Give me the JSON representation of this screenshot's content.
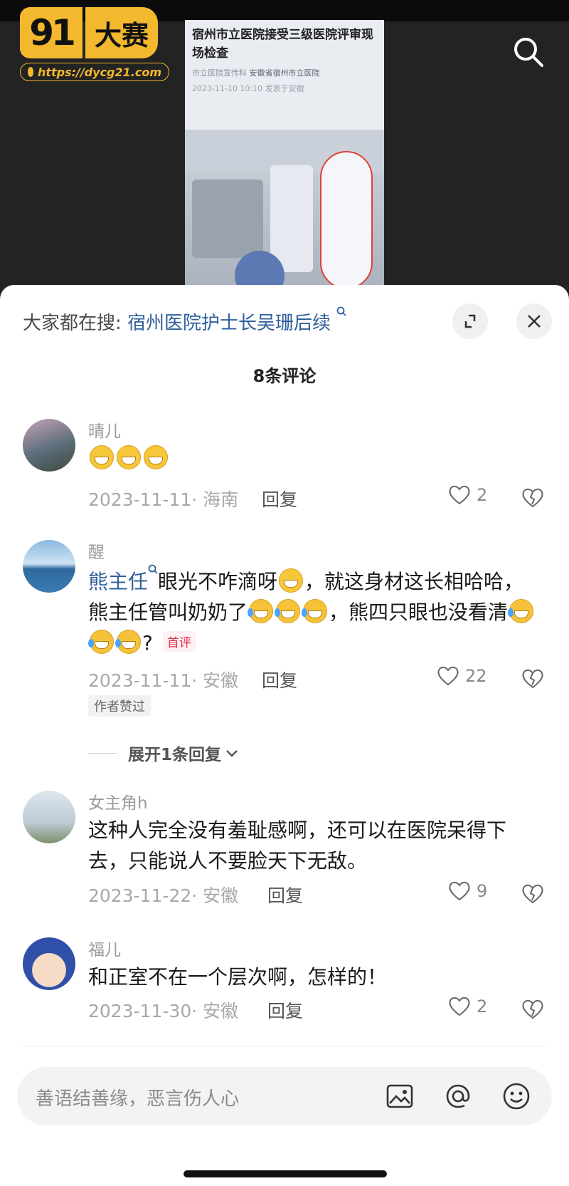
{
  "logo": {
    "num": "91",
    "word": "大赛",
    "url": "https://dycg21.com"
  },
  "article": {
    "title": "宿州市立医院接受三级医院评审现场检查",
    "source": "市立医院宣传科",
    "org": "安徽省宿州市立医院",
    "date": "2023-11-10 10:10",
    "location": "发表于安徽"
  },
  "search": {
    "prefix": "大家都在搜:",
    "term": "宿州医院护士长吴珊后续"
  },
  "comments_title": "8条评论",
  "comments": [
    {
      "name": "晴儿",
      "date": "2023-11-11· 海南",
      "reply": "回复",
      "likes": "2"
    },
    {
      "name": "醒",
      "mention": "熊主任",
      "text_a": "眼光不咋滴呀",
      "text_b": "，就这身材这长相哈哈，熊主任管叫奶奶了",
      "text_c": "，熊四只眼也没看清",
      "text_d": "?",
      "badge": "首评",
      "date": "2023-11-11· 安徽",
      "reply": "回复",
      "likes": "22",
      "author_badge": "作者赞过"
    },
    {
      "name": "女主角h",
      "text": "这种人完全没有羞耻感啊，还可以在医院呆得下去，只能说人不要脸天下无敌。",
      "date": "2023-11-22· 安徽",
      "reply": "回复",
      "likes": "9"
    },
    {
      "name": "福儿",
      "text": "和正室不在一个层次啊，怎样的！",
      "date": "2023-11-30· 安徽",
      "reply": "回复",
      "likes": "2"
    }
  ],
  "expand_label": "展开1条回复",
  "input": {
    "placeholder": "善语结善缘，恶言伤人心"
  },
  "colors": {
    "accent_blue": "#2f5f9a",
    "logo_yellow": "#f3b82d",
    "badge_red": "#e0304b"
  }
}
